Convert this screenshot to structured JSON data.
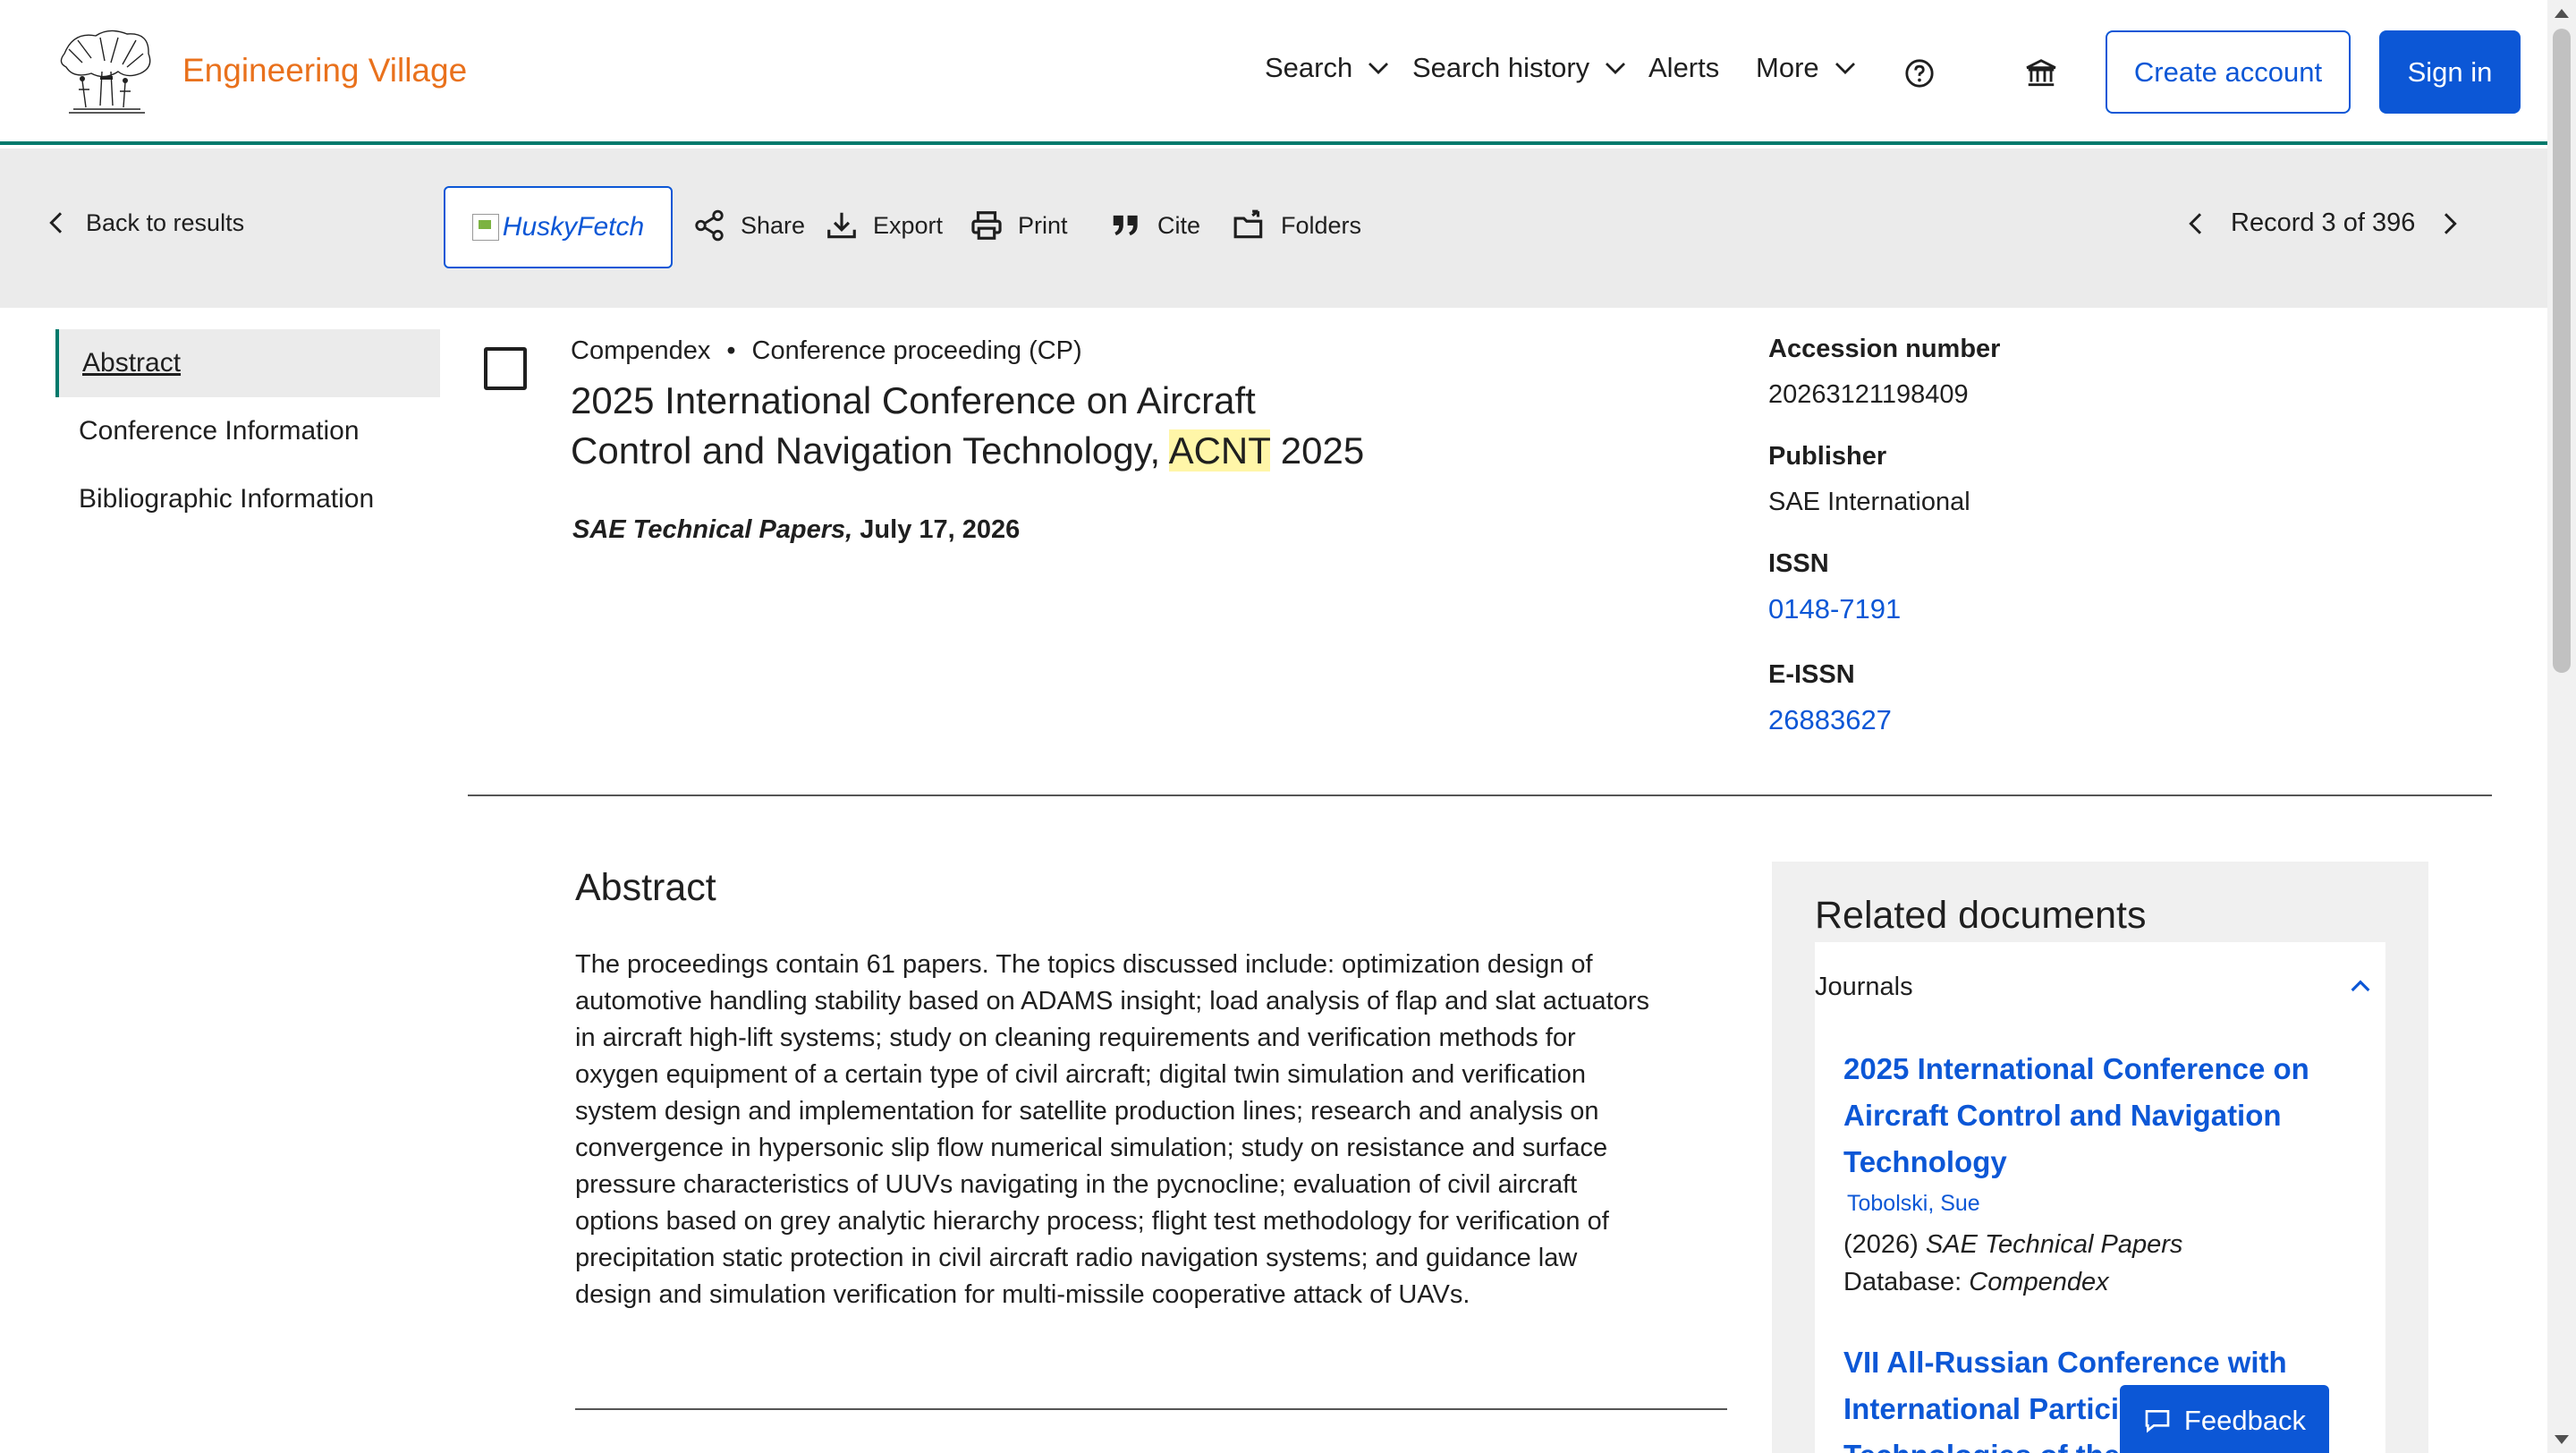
{
  "header": {
    "brand": "Engineering Village",
    "nav": {
      "search": "Search",
      "search_history": "Search history",
      "alerts": "Alerts",
      "more": "More"
    },
    "create_account": "Create account",
    "sign_in": "Sign in",
    "icons": [
      "help-icon",
      "institution-icon"
    ]
  },
  "toolbar": {
    "back": "Back to results",
    "husky": "HuskyFetch",
    "share": "Share",
    "export": "Export",
    "print": "Print",
    "cite": "Cite",
    "folders": "Folders",
    "record": "Record 3 of 396"
  },
  "sidenav": {
    "items": [
      "Abstract",
      "Conference Information",
      "Bibliographic Information"
    ]
  },
  "record": {
    "database": "Compendex",
    "doc_type": "Conference proceeding (CP)",
    "title_line1": "2025 International Conference on Aircraft",
    "title_line2_pre": "Control and Navigation Technology, ",
    "title_highlight": "ACNT",
    "title_line2_post": " 2025",
    "source_italic": "SAE Technical Papers,",
    "source_date": " July 17, 2026"
  },
  "metadata": {
    "accession_label": "Accession number",
    "accession_value": "20263121198409",
    "publisher_label": "Publisher",
    "publisher_value": "SAE International",
    "issn_label": "ISSN",
    "issn_value": "0148-7191",
    "eissn_label": "E-ISSN",
    "eissn_value": "26883627"
  },
  "abstract": {
    "heading": "Abstract",
    "lines": [
      "The proceedings contain 61 papers. The topics discussed include: optimization design of",
      "automotive handling stability based on ADAMS insight; load analysis of flap and slat actuators",
      "in aircraft high-lift systems; study on cleaning requirements and verification methods for",
      "oxygen equipment of a certain type of civil aircraft; digital twin simulation and verification",
      "system design and implementation for satellite production lines; research and analysis on",
      "convergence in hypersonic slip flow numerical simulation; study on resistance and surface",
      "pressure characteristics of UUVs navigating in the pycnocline; evaluation of civil aircraft",
      "options based on grey analytic hierarchy process; flight test methodology for verification of",
      "precipitation static protection in civil aircraft radio navigation systems; and guidance law",
      "design and simulation verification for multi-missile cooperative attack of UAVs."
    ]
  },
  "related": {
    "heading": "Related documents",
    "section": "Journals",
    "items": [
      {
        "title_lines": [
          "2025 International Conference on",
          "Aircraft Control and Navigation",
          "Technology"
        ],
        "author": "Tobolski, Sue",
        "year": "(2026) ",
        "journal": "SAE Technical Papers",
        "db_label": "Database: ",
        "db": "Compendex"
      },
      {
        "title_lines": [
          "VII All-Russian Conference with",
          "International Partici",
          "Technologies of the"
        ]
      }
    ]
  },
  "feedback": "Feedback"
}
